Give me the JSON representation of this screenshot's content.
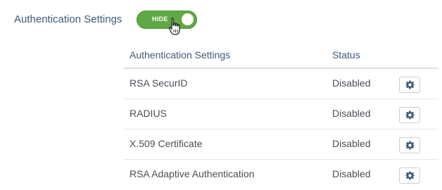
{
  "section": {
    "label": "Authentication Settings"
  },
  "toggle": {
    "label": "HIDE",
    "color": "#5fa944"
  },
  "table": {
    "headers": {
      "name": "Authentication Settings",
      "status": "Status"
    },
    "rows": [
      {
        "name": "RSA SecurID",
        "status": "Disabled",
        "action_icon": "gear-icon"
      },
      {
        "name": "RADIUS",
        "status": "Disabled",
        "action_icon": "gear-icon"
      },
      {
        "name": "X.509 Certificate",
        "status": "Disabled",
        "action_icon": "gear-icon"
      },
      {
        "name": "RSA Adaptive Authentication",
        "status": "Disabled",
        "action_icon": "gear-icon"
      }
    ]
  },
  "colors": {
    "heading": "#3c5a78",
    "text": "#4a4f55",
    "toggle_on": "#5fa944",
    "gear": "#3c5a78"
  }
}
